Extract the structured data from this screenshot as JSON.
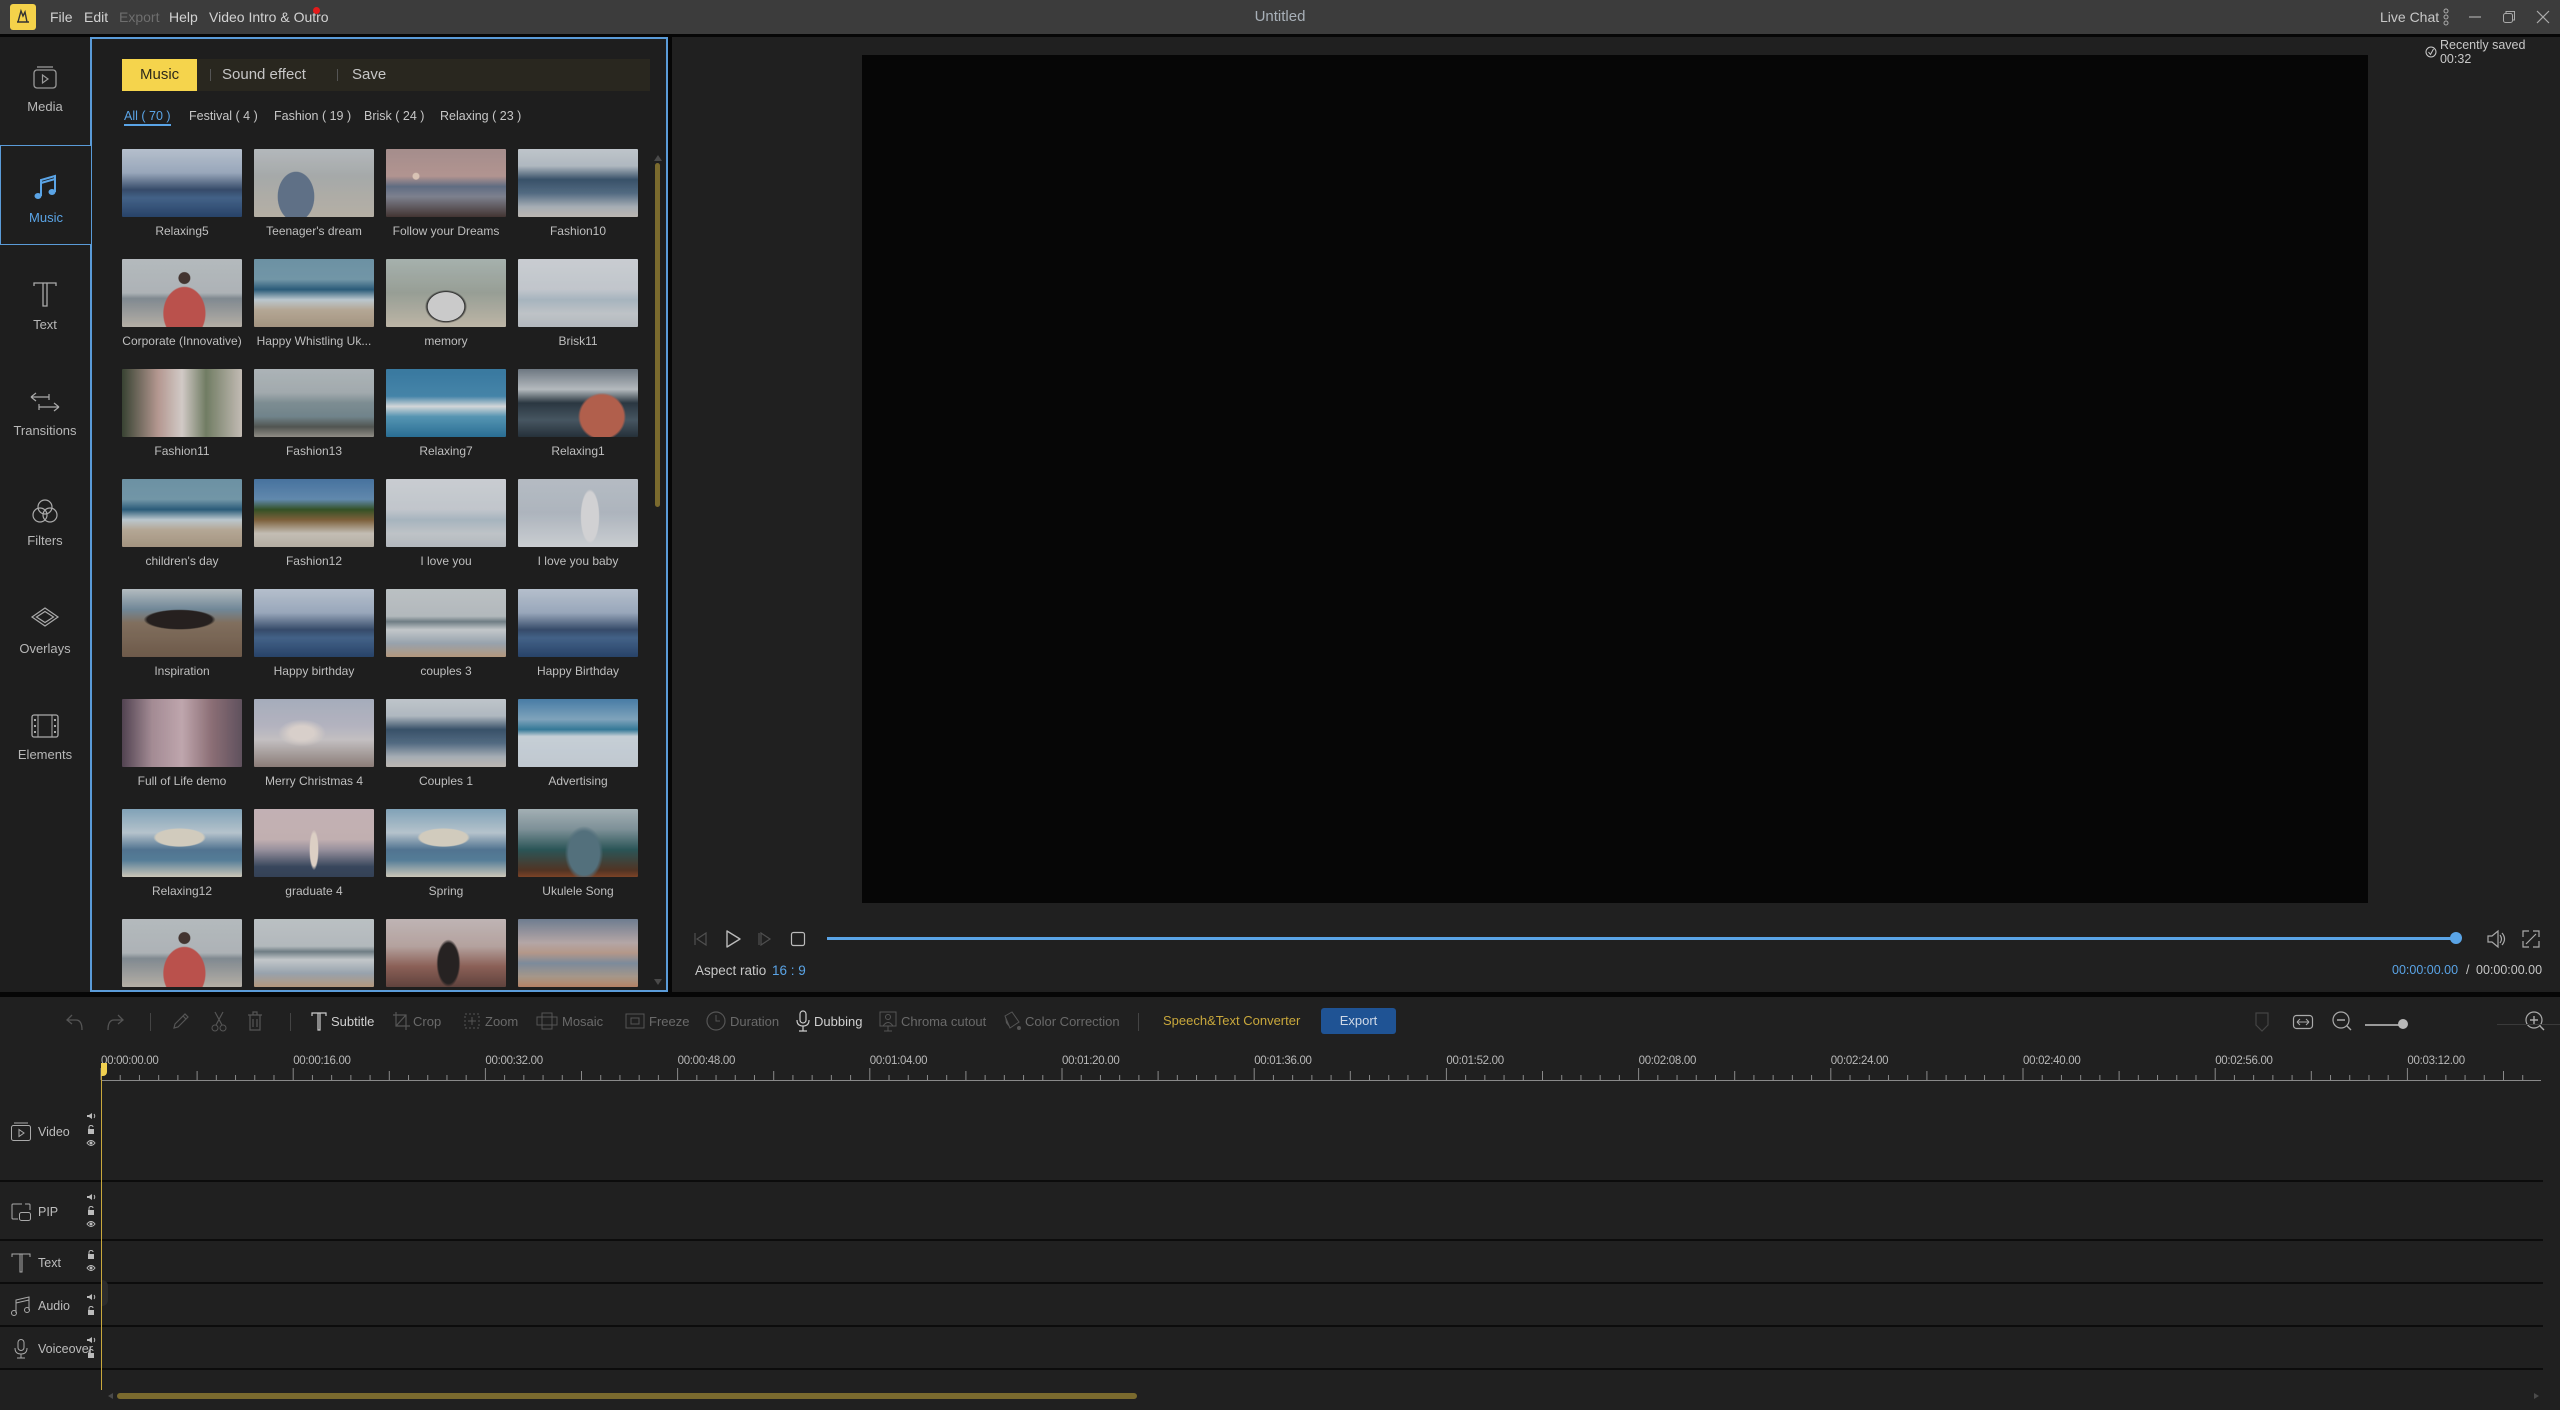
{
  "app": {
    "title": "Untitled",
    "menu": [
      {
        "label": "File",
        "enabled": true
      },
      {
        "label": "Edit",
        "enabled": true
      },
      {
        "label": "Export",
        "enabled": false
      },
      {
        "label": "Help",
        "enabled": true
      },
      {
        "label": "Video Intro & Outro",
        "enabled": true,
        "badge": "red-dot"
      }
    ],
    "live_chat": "Live Chat",
    "window_controls": [
      "more-icon",
      "minimize-icon",
      "restore-icon",
      "close-icon"
    ]
  },
  "sidebar": {
    "items": [
      {
        "label": "Media",
        "icon": "media-icon",
        "active": false
      },
      {
        "label": "Music",
        "icon": "music-note-icon",
        "active": true
      },
      {
        "label": "Text",
        "icon": "text-icon",
        "active": false
      },
      {
        "label": "Transitions",
        "icon": "transitions-icon",
        "active": false
      },
      {
        "label": "Filters",
        "icon": "filters-icon",
        "active": false
      },
      {
        "label": "Overlays",
        "icon": "overlays-icon",
        "active": false
      },
      {
        "label": "Elements",
        "icon": "elements-icon",
        "active": false
      }
    ]
  },
  "media_panel": {
    "tabs": [
      {
        "label": "Music",
        "active": true
      },
      {
        "label": "Sound effect",
        "active": false
      },
      {
        "label": "Save",
        "active": false
      }
    ],
    "categories": [
      {
        "label": "All ( 70 )",
        "active": true
      },
      {
        "label": "Festival ( 4 )",
        "active": false
      },
      {
        "label": "Fashion ( 19 )",
        "active": false
      },
      {
        "label": "Brisk ( 24 )",
        "active": false
      },
      {
        "label": "Relaxing ( 23 )",
        "active": false
      }
    ],
    "tracks": [
      {
        "title": "Relaxing5",
        "scene": "snow-mountain-sea"
      },
      {
        "title": "Teenager's dream",
        "scene": "girl-beach"
      },
      {
        "title": "Follow your Dreams",
        "scene": "sunset-beach"
      },
      {
        "title": "Fashion10",
        "scene": "mountains"
      },
      {
        "title": "Corporate (Innovative)",
        "scene": "woman-red-sweater-beach"
      },
      {
        "title": "Happy Whistling Uk...",
        "scene": "couple-waves"
      },
      {
        "title": "memory",
        "scene": "sneakers-car"
      },
      {
        "title": "Brisk11",
        "scene": "misty-shore"
      },
      {
        "title": "Fashion11",
        "scene": "church-street"
      },
      {
        "title": "Fashion13",
        "scene": "grey-coast"
      },
      {
        "title": "Relaxing7",
        "scene": "turquoise-beach"
      },
      {
        "title": "Relaxing1",
        "scene": "hiker-lake"
      },
      {
        "title": "children's day",
        "scene": "couple-waves"
      },
      {
        "title": "Fashion12",
        "scene": "beach-huts"
      },
      {
        "title": "I love you",
        "scene": "misty-shore"
      },
      {
        "title": "I love you baby",
        "scene": "woman-white-town"
      },
      {
        "title": "Inspiration",
        "scene": "sunglasses-sand"
      },
      {
        "title": "Happy birthday",
        "scene": "snow-mountain-sea"
      },
      {
        "title": "couples 3",
        "scene": "pier-waves"
      },
      {
        "title": "Happy Birthday",
        "scene": "snow-mountain-sea"
      },
      {
        "title": "Full of Life demo",
        "scene": "venice-canal"
      },
      {
        "title": "Merry Christmas 4",
        "scene": "sunrise-waves"
      },
      {
        "title": "Couples 1",
        "scene": "mountains"
      },
      {
        "title": "Advertising",
        "scene": "dancing-beach"
      },
      {
        "title": "Relaxing12",
        "scene": "umbrella-beach"
      },
      {
        "title": "graduate 4",
        "scene": "pink-sunset-sea"
      },
      {
        "title": "Spring",
        "scene": "umbrella-beach"
      },
      {
        "title": "Ukulele Song",
        "scene": "boat-lake"
      },
      {
        "title": "",
        "scene": "woman-red-sweater-beach"
      },
      {
        "title": "",
        "scene": "pier-waves"
      },
      {
        "title": "",
        "scene": "woman-canyon"
      },
      {
        "title": "",
        "scene": "dusk-beach"
      }
    ],
    "scrollbar_position": 0
  },
  "preview": {
    "saved_status": "Recently saved 00:32",
    "aspect_ratio_label": "Aspect ratio",
    "aspect_ratio_value": "16 : 9",
    "current_time": "00:00:00.00",
    "time_separator": "/",
    "total_time": "00:00:00.00",
    "progress": 1.0
  },
  "toolbar": {
    "buttons": [
      {
        "label": "",
        "icon": "undo-icon",
        "enabled": false
      },
      {
        "label": "",
        "icon": "redo-icon",
        "enabled": false
      },
      {
        "label": "",
        "icon": "edit-pencil-icon",
        "enabled": false
      },
      {
        "label": "",
        "icon": "scissors-icon",
        "enabled": false
      },
      {
        "label": "",
        "icon": "trash-icon",
        "enabled": false
      },
      {
        "label": "Subtitle",
        "icon": "subtitle-icon",
        "enabled": true
      },
      {
        "label": "Crop",
        "icon": "crop-icon",
        "enabled": false
      },
      {
        "label": "Zoom",
        "icon": "zoom-frame-icon",
        "enabled": false
      },
      {
        "label": "Mosaic",
        "icon": "mosaic-icon",
        "enabled": false
      },
      {
        "label": "Freeze",
        "icon": "freeze-icon",
        "enabled": false
      },
      {
        "label": "Duration",
        "icon": "clock-icon",
        "enabled": false
      },
      {
        "label": "Dubbing",
        "icon": "microphone-icon",
        "enabled": true
      },
      {
        "label": "Chroma cutout",
        "icon": "chroma-icon",
        "enabled": false
      },
      {
        "label": "Color Correction",
        "icon": "color-bucket-icon",
        "enabled": false
      }
    ],
    "speech_converter": "Speech&Text Converter",
    "export": "Export",
    "timeline_zoom": 0.4
  },
  "timeline": {
    "ruler_labels": [
      "00:00:00.00",
      "00:00:16.00",
      "00:00:32.00",
      "00:00:48.00",
      "00:01:04.00",
      "00:01:20.00",
      "00:01:36.00",
      "00:01:52.00",
      "00:02:08.00",
      "00:02:24.00",
      "00:02:40.00",
      "00:02:56.00",
      "00:03:12.00"
    ],
    "tracks": [
      {
        "label": "Video",
        "icon": "video-track-icon",
        "controls": [
          "speaker-icon",
          "lock-icon",
          "eye-icon"
        ]
      },
      {
        "label": "PIP",
        "icon": "pip-icon",
        "controls": [
          "speaker-icon",
          "lock-icon",
          "eye-icon"
        ]
      },
      {
        "label": "Text",
        "icon": "text-track-icon",
        "controls": [
          "lock-icon",
          "eye-icon"
        ]
      },
      {
        "label": "Audio",
        "icon": "audio-track-icon",
        "controls": [
          "speaker-icon",
          "lock-icon"
        ]
      },
      {
        "label": "Voiceover",
        "icon": "voiceover-icon",
        "controls": [
          "speaker-icon",
          "lock-icon"
        ]
      }
    ],
    "playhead_time": "00:00:00.00"
  },
  "colors": {
    "accent_blue": "#5aa4e6",
    "accent_yellow": "#f5d44c",
    "gold_text": "#c9a83c",
    "export_blue": "#1f5394",
    "scrollbar": "#7a6a2e"
  }
}
